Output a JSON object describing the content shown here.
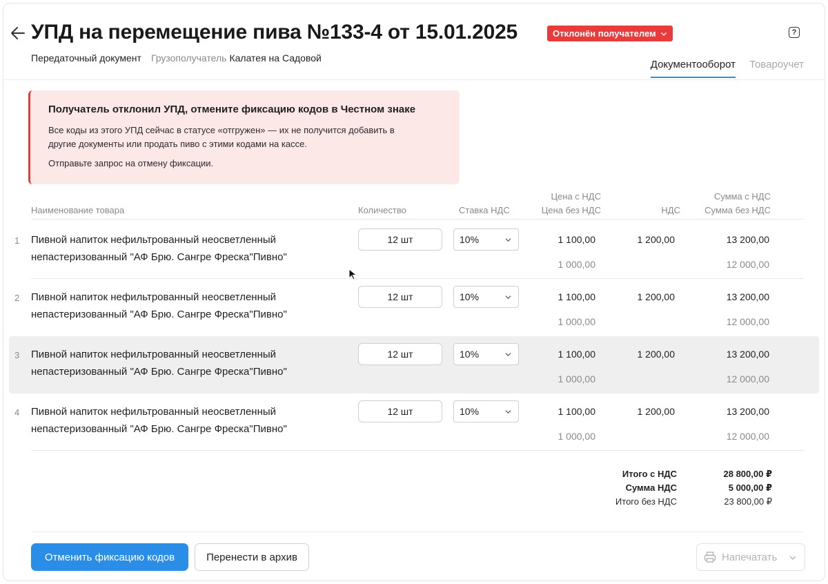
{
  "header": {
    "title": "УПД на перемещение пива №133-4 от 15.01.2025",
    "status": "Отклонён получателем",
    "status_color": "#e83b3b",
    "doc_type": "Передаточный документ",
    "consignee_label": "Грузополучатель",
    "consignee_value": "Калатея на Садовой",
    "help_icon": "?"
  },
  "tabs": [
    {
      "label": "Документооборот",
      "active": true
    },
    {
      "label": "Товароучет",
      "active": false
    }
  ],
  "alert": {
    "title": "Получатель отклонил УПД, отмените фиксацию кодов в Честном знаке",
    "text": "Все коды из этого УПД сейчас в статусе «отгружен» — их не получится добавить в другие документы или продать пиво с этими кодами на кассе.",
    "text2": "Отправьте запрос на отмену фиксации."
  },
  "table": {
    "headers": {
      "name": "Наименование товара",
      "qty": "Количество",
      "vat_rate": "Ставка НДС",
      "price_with_vat": "Цена с НДС",
      "price_without_vat": "Цена без НДС",
      "vat": "НДС",
      "sum_with_vat": "Сумма с НДС",
      "sum_without_vat": "Сумма без НДС"
    },
    "rows": [
      {
        "num": "1",
        "name": "Пивной напиток нефильтрованный неосветленный непастеризованный \"АФ Брю. Сангре Фреска\"Пивно\"",
        "qty": "12 шт",
        "vat_rate": "10%",
        "price": "1 100,00",
        "price_no_vat": "1 000,00",
        "vat": "1 200,00",
        "sum": "13 200,00",
        "sum_no_vat": "12 000,00"
      },
      {
        "num": "2",
        "name": "Пивной напиток нефильтрованный неосветленный непастеризованный \"АФ Брю. Сангре Фреска\"Пивно\"",
        "qty": "12 шт",
        "vat_rate": "10%",
        "price": "1 100,00",
        "price_no_vat": "1 000,00",
        "vat": "1 200,00",
        "sum": "13 200,00",
        "sum_no_vat": "12 000,00"
      },
      {
        "num": "3",
        "name": "Пивной напиток нефильтрованный неосветленный непастеризованный \"АФ Брю. Сангре Фреска\"Пивно\"",
        "qty": "12 шт",
        "vat_rate": "10%",
        "price": "1 100,00",
        "price_no_vat": "1 000,00",
        "vat": "1 200,00",
        "sum": "13 200,00",
        "sum_no_vat": "12 000,00"
      },
      {
        "num": "4",
        "name": "Пивной напиток нефильтрованный неосветленный непастеризованный \"АФ Брю. Сангре Фреска\"Пивно\"",
        "qty": "12 шт",
        "vat_rate": "10%",
        "price": "1 100,00",
        "price_no_vat": "1 000,00",
        "vat": "1 200,00",
        "sum": "13 200,00",
        "sum_no_vat": "12 000,00"
      }
    ]
  },
  "totals": {
    "total_with_vat_label": "Итого с НДС",
    "total_with_vat": "28 800,00 ₽",
    "vat_sum_label": "Сумма НДС",
    "vat_sum": "5 000,00 ₽",
    "total_without_vat_label": "Итого без НДС",
    "total_without_vat": "23 800,00 ₽"
  },
  "actions": {
    "cancel_fixation": "Отменить фиксацию кодов",
    "archive": "Перенести в архив",
    "print": "Напечатать"
  },
  "colors": {
    "accent": "#2a8ee8",
    "alert_bg": "#fde8e8",
    "highlight_row": "#efefef"
  }
}
